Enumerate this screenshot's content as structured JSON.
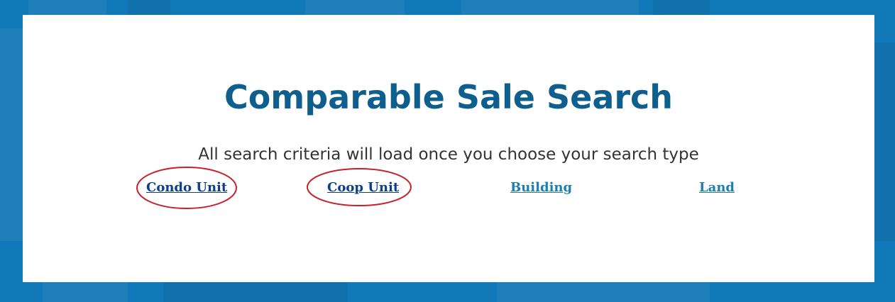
{
  "page": {
    "title": "Comparable Sale Search",
    "subtitle": "All search criteria will load once you choose your search type"
  },
  "search_types": [
    {
      "label": "Condo Unit"
    },
    {
      "label": "Coop Unit"
    },
    {
      "label": "Building"
    },
    {
      "label": "Land"
    }
  ],
  "colors": {
    "background": "#1279b8",
    "title": "#0f5f8e",
    "link_visited": "#0d3f8a",
    "link": "#1d7fb0",
    "annotation": "#c8202a"
  }
}
